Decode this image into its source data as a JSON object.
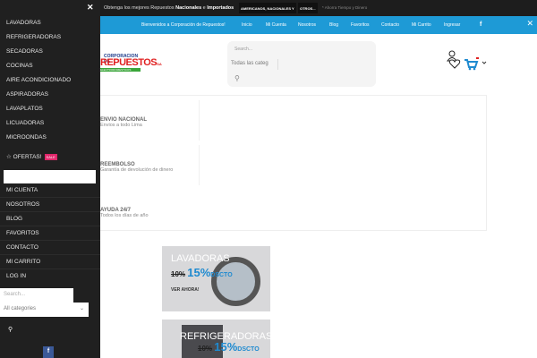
{
  "topbar": {
    "msg_pre": "Obtenga los mejores Repuestos ",
    "msg_b1": "Nacionales",
    "msg_mid": " e ",
    "msg_b2": "Importados",
    "pill1": "AMERICANOS, NACIONALES Y",
    "pill2": "OTROS...",
    "note": "* Ahorra Tiempo y Dinero"
  },
  "nav": {
    "welcome": "Bienvenidos a Corporación de Repuestos!",
    "items": [
      "Inicio",
      "Mi Cuenta",
      "Nosotros",
      "Blog",
      "Favoritos",
      "Contacto",
      "Mi Carrito",
      "Ingresar"
    ],
    "fb": "f",
    "close": "✕"
  },
  "logo": {
    "l1": "CORPORACION DE",
    "l2": "REPUESTOS",
    "l2b": "S.A",
    "l3": "ELECTRODOMESTICOS"
  },
  "search": {
    "placeholder": "Search...",
    "category": "Todas las categ"
  },
  "features": [
    {
      "title": "ENVIO NACIONAL",
      "sub": "Envios a todo Lima"
    },
    {
      "title": "REEMBOLSO",
      "sub": "Garantía de devolución de dinero"
    },
    {
      "title": "AYUDA 24/7",
      "sub": "Todos los días de año"
    }
  ],
  "banners": [
    {
      "title": "LAVADORAS",
      "old": "10%",
      "pct": "15%",
      "dscto": "DSCTO",
      "cta": "VER AHORA!"
    },
    {
      "title": "REFRIGERADORAS",
      "old": "10%",
      "pct": "15%",
      "dscto": "DSCTO"
    }
  ],
  "sidebar": {
    "close": "✕",
    "categories": [
      "LAVADORAS",
      "REFRIGERADORAS",
      "SECADORAS",
      "COCINAS",
      "AIRE ACONDICIONADO",
      "ASPIRADORAS",
      "LAVAPLATOS",
      "LICUADORAS",
      "MICROONDAS"
    ],
    "ofertas": "OFERTAS!",
    "sale": "SALE",
    "links": [
      "MI CUENTA",
      "NOSOTROS",
      "BLOG",
      "FAVORITOS",
      "CONTACTO",
      "MI CARRITO",
      "LOG IN"
    ],
    "search_placeholder": "Search...",
    "select": "All categories",
    "fb": "f"
  }
}
